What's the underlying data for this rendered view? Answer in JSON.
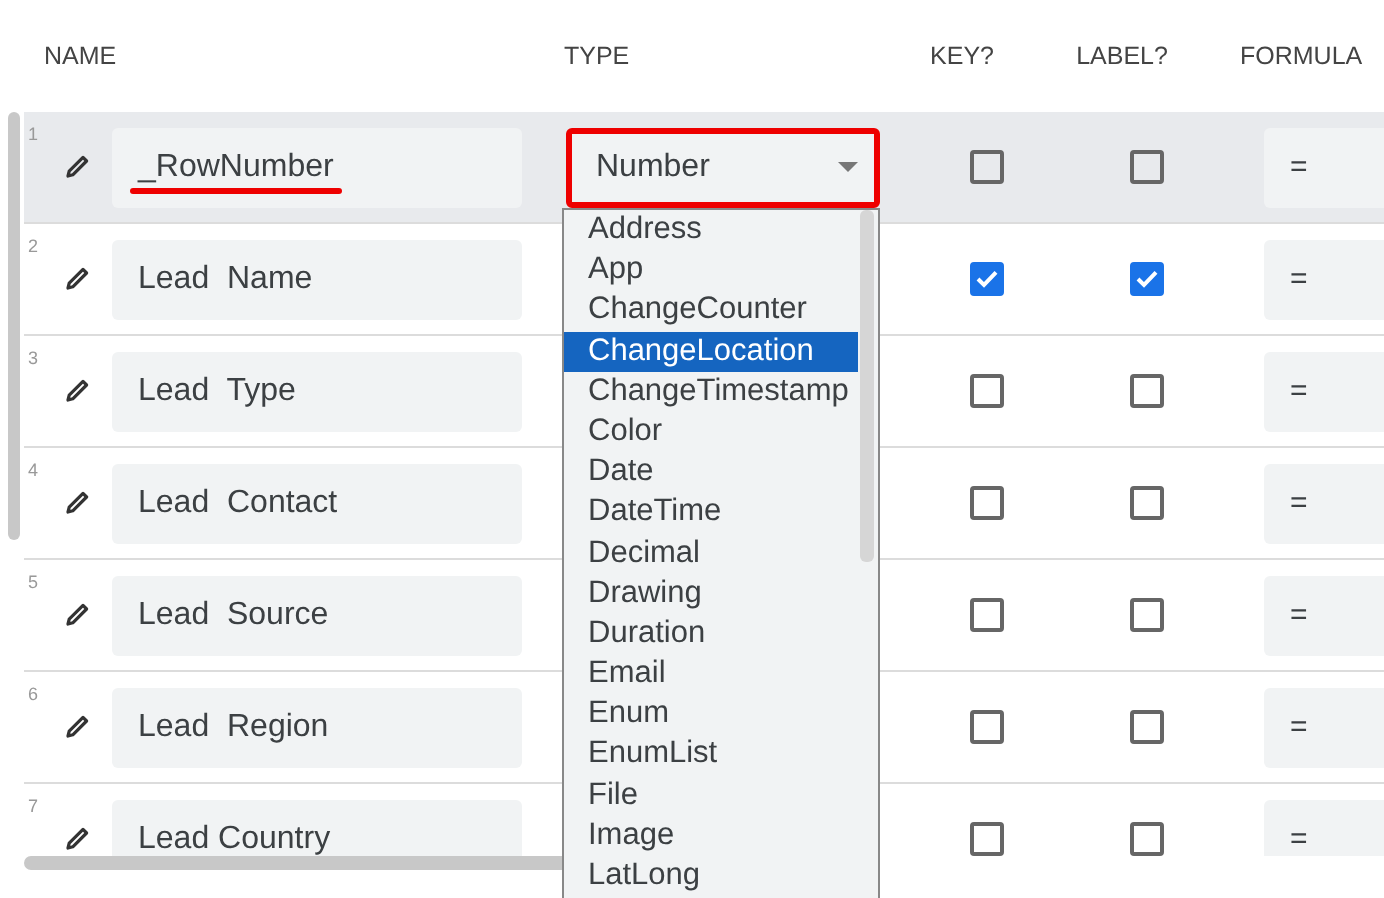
{
  "columns": [
    "NAME",
    "TYPE",
    "KEY?",
    "LABEL?",
    "FORMULA"
  ],
  "rows": [
    {
      "number": "1",
      "name": "_RowNumber",
      "type": "Number",
      "key": false,
      "label": false,
      "formula": "=",
      "selected": true,
      "annotated": true
    },
    {
      "number": "2",
      "name": "Lead  Name",
      "key": true,
      "label": true,
      "formula": "=",
      "selected": false,
      "annotated": false
    },
    {
      "number": "3",
      "name": "Lead  Type",
      "key": false,
      "label": false,
      "formula": "=",
      "selected": false,
      "annotated": false
    },
    {
      "number": "4",
      "name": "Lead  Contact",
      "key": false,
      "label": false,
      "formula": "=",
      "selected": false,
      "annotated": false
    },
    {
      "number": "5",
      "name": "Lead  Source",
      "key": false,
      "label": false,
      "formula": "=",
      "selected": false,
      "annotated": false
    },
    {
      "number": "6",
      "name": "Lead  Region",
      "key": false,
      "label": false,
      "formula": "=",
      "selected": false,
      "annotated": false
    },
    {
      "number": "7",
      "name": "Lead Country",
      "key": false,
      "label": false,
      "formula": "=",
      "selected": false,
      "annotated": false
    }
  ],
  "dropdown": {
    "options": [
      {
        "label": "Address",
        "selected": false
      },
      {
        "label": "App",
        "selected": false
      },
      {
        "label": "ChangeCounter",
        "selected": false
      },
      {
        "label": "ChangeLocation",
        "selected": true
      },
      {
        "label": "ChangeTimestamp",
        "selected": false
      },
      {
        "label": "Color",
        "selected": false
      },
      {
        "label": "Date",
        "selected": false
      },
      {
        "label": "DateTime",
        "selected": false
      },
      {
        "label": "Decimal",
        "selected": false
      },
      {
        "label": "Drawing",
        "selected": false
      },
      {
        "label": "Duration",
        "selected": false
      },
      {
        "label": "Email",
        "selected": false
      },
      {
        "label": "Enum",
        "selected": false
      },
      {
        "label": "EnumList",
        "selected": false
      },
      {
        "label": "File",
        "selected": false
      },
      {
        "label": "Image",
        "selected": false
      },
      {
        "label": "LatLong",
        "selected": false
      }
    ]
  }
}
